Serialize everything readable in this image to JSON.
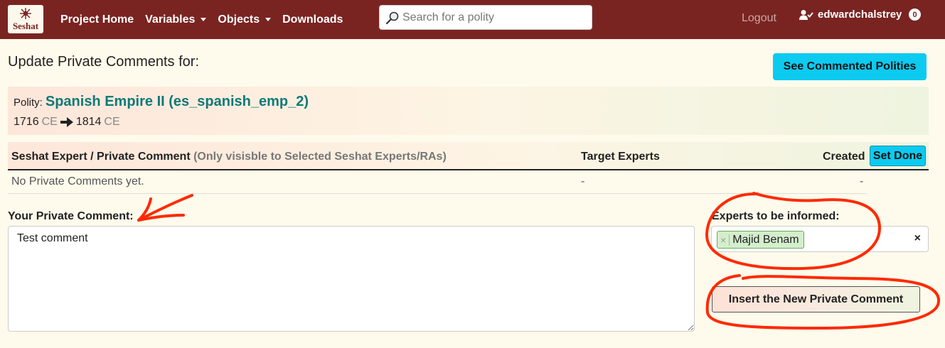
{
  "navbar": {
    "logo_text": "Seshat",
    "links": [
      {
        "label": "Project Home"
      },
      {
        "label": "Variables"
      },
      {
        "label": "Objects"
      },
      {
        "label": "Downloads"
      }
    ],
    "search_placeholder": "Search for a polity",
    "logout": "Logout",
    "username": "edwardchalstrey",
    "notification_count": "0"
  },
  "page": {
    "title": "Update Private Comments for:",
    "see_commented_button": "See Commented Polities"
  },
  "polity": {
    "label": "Polity:",
    "name": "Spanish Empire II (es_spanish_emp_2)",
    "start_year": "1716",
    "start_era": "CE",
    "end_year": "1814",
    "end_era": "CE"
  },
  "table": {
    "col_comment": "Seshat Expert / Private Comment",
    "col_comment_note": "(Only visisble to Selected Seshat Experts/RAs)",
    "col_targets": "Target Experts",
    "col_created": "Created",
    "set_done_button": "Set Done",
    "rows": [
      {
        "comment": "No Private Comments yet.",
        "targets": "-",
        "created": "-"
      }
    ]
  },
  "form": {
    "comment_label": "Your Private Comment:",
    "comment_value": "Test comment",
    "experts_label": "Experts to be informed:",
    "selected_experts": [
      "Majid Benam"
    ],
    "chip_remove": "×",
    "clear_all": "×",
    "submit_button": "Insert the New Private Comment"
  },
  "colors": {
    "navbar": "#7a2422",
    "page_bg": "#fefbec",
    "accent_cyan": "#0dcaf0",
    "polity_link": "#0e7a78",
    "annotation_red": "#ff2a00"
  }
}
